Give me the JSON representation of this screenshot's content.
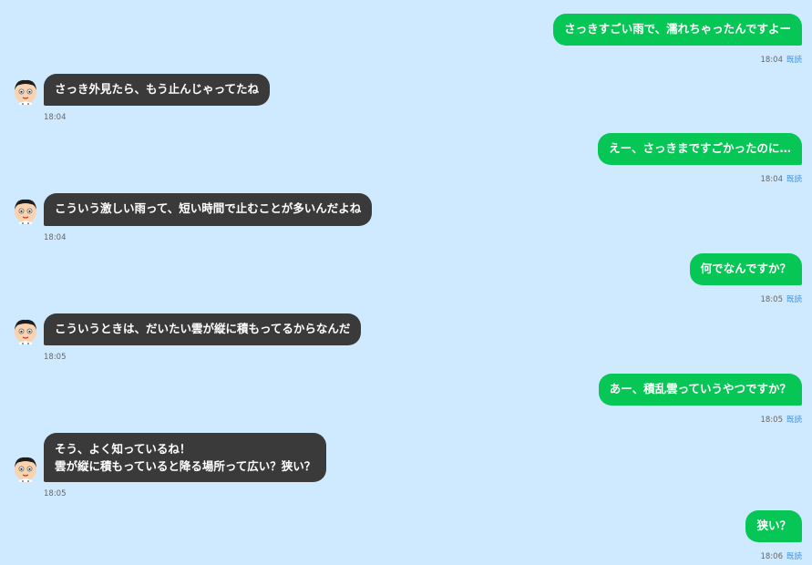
{
  "messages": [
    {
      "side": "right",
      "text": "さっきすごい雨で、濡れちゃったんですよー",
      "time": "18:04",
      "read": "既読"
    },
    {
      "side": "left",
      "text": "さっき外見たら、もう止んじゃってたね",
      "time": "18:04"
    },
    {
      "side": "right",
      "text": "えー、さっきまですごかったのに…",
      "time": "18:04",
      "read": "既読"
    },
    {
      "side": "left",
      "text": "こういう激しい雨って、短い時間で止むことが多いんだよね",
      "time": "18:04"
    },
    {
      "side": "right",
      "text": "何でなんですか？",
      "time": "18:05",
      "read": "既読"
    },
    {
      "side": "left",
      "text": "こういうときは、だいたい雲が縦に積もってるからなんだ",
      "time": "18:05"
    },
    {
      "side": "right",
      "text": "あー、積乱雲っていうやつですか？",
      "time": "18:05",
      "read": "既読"
    },
    {
      "side": "left",
      "line1": "そう、よく知っているね！",
      "line2": "雲が縦に積もっていると降る場所って広い？狭い？",
      "time": "18:05"
    },
    {
      "side": "right",
      "text": "狭い？",
      "time": "18:06",
      "read": "既読"
    }
  ],
  "colors": {
    "background": "#cfe9ff",
    "sent_bubble": "#06c755",
    "received_bubble": "#3a3a3a",
    "read_label": "#3a8fdc"
  }
}
